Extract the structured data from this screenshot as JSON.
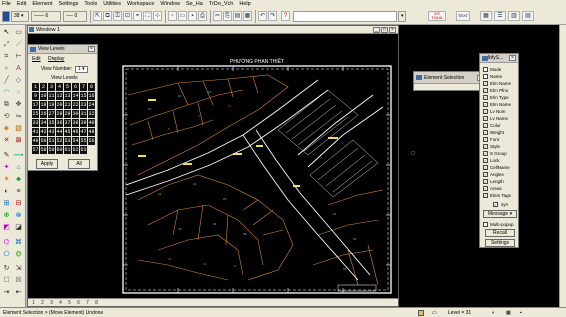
{
  "menu": [
    "File",
    "Edit",
    "Element",
    "Settings",
    "Tools",
    "Utilities",
    "Workspace",
    "Window",
    "Se_Ha",
    "TrDo_Vch",
    "Help"
  ],
  "toolbar": {
    "color_value": "38",
    "weight_value": "0",
    "linestyle_value": "6",
    "command_field": "",
    "btn_tag_label": "V.E\nTHUA",
    "btn_text_label": "TEXT"
  },
  "view_window": {
    "title": "Window 1",
    "drawing_title": "PHƯỜNG PHAN THIẾT",
    "view_buttons": [
      "1",
      "2",
      "3",
      "4",
      "5",
      "6",
      "7",
      "8"
    ]
  },
  "view_levels": {
    "title": "View Levels",
    "tabs": [
      "Edit",
      "Display"
    ],
    "view_number_label": "View Number:",
    "view_number_value": "1",
    "levels_label": "View Levels",
    "levels": [
      "1",
      "2",
      "3",
      "4",
      "5",
      "6",
      "7",
      "8",
      "9",
      "10",
      "11",
      "12",
      "13",
      "14",
      "15",
      "16",
      "17",
      "18",
      "19",
      "20",
      "21",
      "22",
      "23",
      "24",
      "25",
      "26",
      "27",
      "28",
      "29",
      "30",
      "31",
      "32",
      "33",
      "34",
      "35",
      "36",
      "37",
      "38",
      "39",
      "40",
      "41",
      "42",
      "43",
      "44",
      "45",
      "46",
      "47",
      "48",
      "49",
      "50",
      "51",
      "52",
      "53",
      "54",
      "55",
      "56",
      "57",
      "58",
      "59",
      "60",
      "61",
      "62",
      "63"
    ],
    "apply_label": "Apply",
    "all_label": "All"
  },
  "element_selection": {
    "title": "Element Selection"
  },
  "selection_settings": {
    "title": "lbfyS...",
    "items": [
      "Mode",
      "Name",
      "Elm Name",
      "Elm Pfno",
      "Elm Type",
      "Elm Name",
      "Lv Num",
      "Lv Name",
      "Color",
      "Weight",
      "Font",
      "Style",
      "S Group",
      "Lock",
      "CellName",
      "Angles",
      "Length",
      "Areas",
      "Elem Tags"
    ],
    "sync_label": "syn",
    "message_label": "Message",
    "multi_popup_label": "Multi-popup",
    "recall_label": "Recall",
    "settings_label": "Settings"
  },
  "status": {
    "left": "Element Selection > (Move Element) Undone",
    "level": "Level = 31"
  }
}
